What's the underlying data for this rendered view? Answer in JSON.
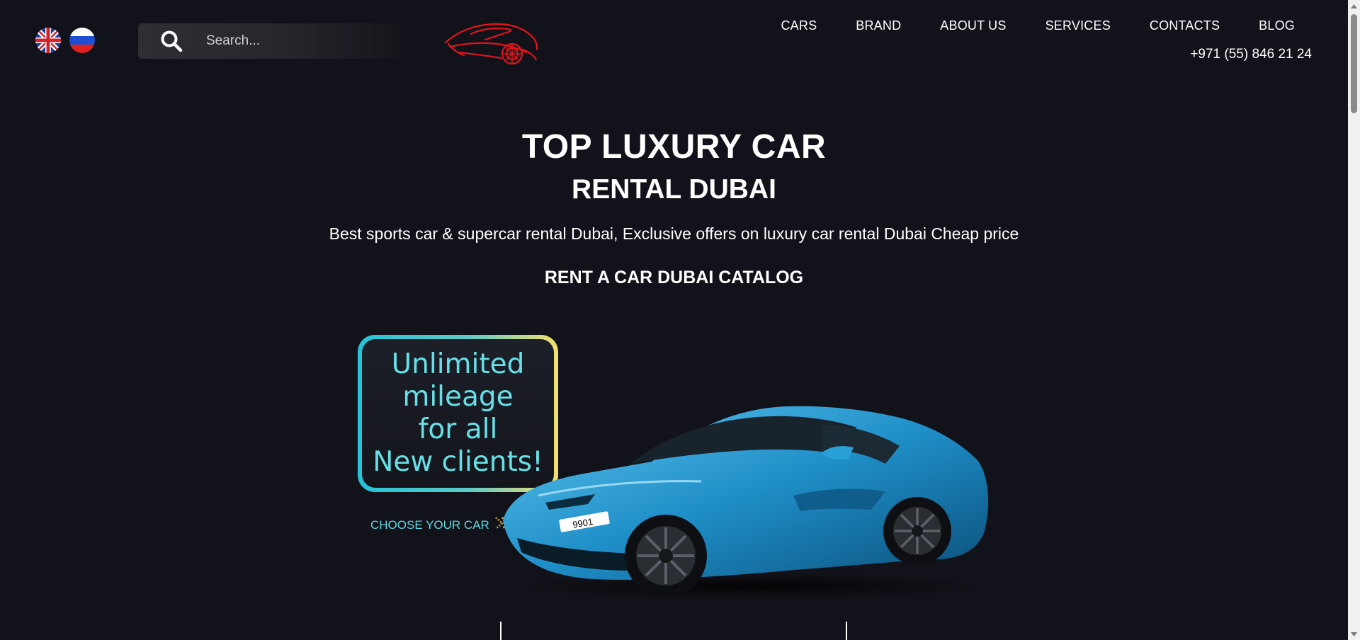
{
  "header": {
    "languages": [
      {
        "code": "en",
        "icon": "uk-flag-icon"
      },
      {
        "code": "ru",
        "icon": "russia-flag-icon"
      }
    ],
    "search": {
      "placeholder": "Search...",
      "value": ""
    },
    "logo_icon": "sports-car-logo-icon",
    "nav": [
      "CARS",
      "BRAND",
      "ABOUT US",
      "SERVICES",
      "CONTACTS",
      "BLOG"
    ],
    "phone": "+971 (55) 846 21 24"
  },
  "hero": {
    "title_line1": "TOP LUXURY CAR",
    "title_line2": "RENTAL DUBAI",
    "subtitle": "Best sports car & supercar rental Dubai, Exclusive offers on luxury car rental Dubai Cheap price",
    "catalog_heading": "RENT A CAR DUBAI CATALOG"
  },
  "promo": {
    "lines": [
      "Unlimited",
      "mileage",
      "for all",
      "New clients!"
    ],
    "cta": "CHOOSE YOUR CAR",
    "plate": "9901"
  },
  "colors": {
    "background": "#12121a",
    "logo_red": "#e0141c",
    "promo_text": "#66e0e6",
    "promo_gradient_start": "#23c4d6",
    "promo_gradient_end": "#f6e06a",
    "car_blue": "#1f8fc8"
  }
}
